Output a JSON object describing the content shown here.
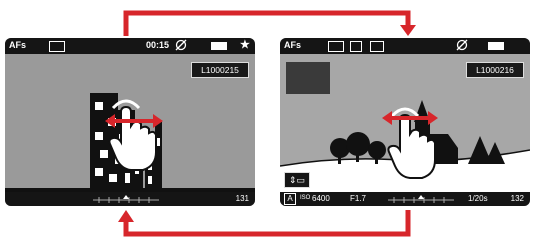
{
  "left_screen": {
    "focus_mode": "AFs",
    "time": "00:15",
    "filename": "L1000215",
    "frame_count": "131",
    "icons": [
      "scene-mode-icon",
      "gps-off-icon",
      "battery-icon",
      "star-icon",
      "touch-swipe-icon"
    ]
  },
  "right_screen": {
    "focus_mode": "AFs",
    "filename": "L1000216",
    "iso": "6400",
    "iso_prefix": "ISO",
    "aperture": "F1.7",
    "shutter": "1/20s",
    "frame_count": "132",
    "exposure_mode": "A",
    "icons": [
      "scene-mode-icon",
      "metering-icon",
      "white-balance-icon",
      "gps-off-icon",
      "battery-icon",
      "playback-toggle-icon",
      "touch-swipe-icon"
    ]
  },
  "colors": {
    "arrow": "#d7262b",
    "screen_bar": "#151515",
    "screen_left": "#9a9a9a",
    "screen_right": "#a7a7a7"
  }
}
